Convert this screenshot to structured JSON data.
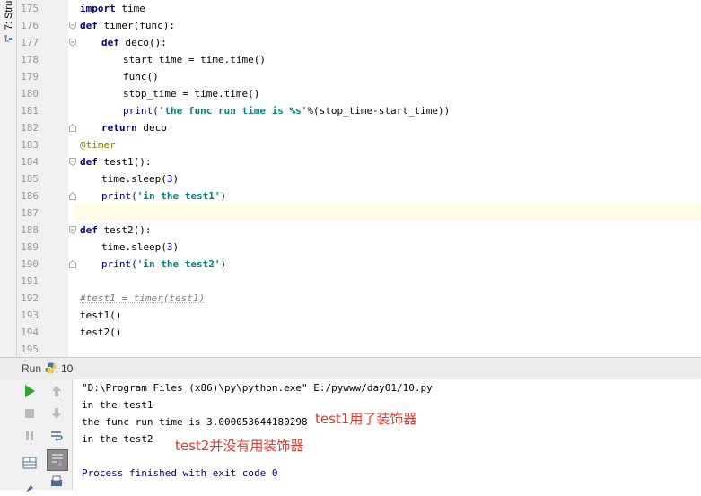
{
  "sidebar": {
    "structure_tab": "7: Stru"
  },
  "editor": {
    "line_numbers": [
      "175",
      "176",
      "177",
      "178",
      "179",
      "180",
      "181",
      "182",
      "183",
      "184",
      "185",
      "186",
      "187",
      "188",
      "189",
      "190",
      "191",
      "192",
      "193",
      "194",
      "195"
    ],
    "code": {
      "l175": {
        "kw": "import",
        "rest": " time"
      },
      "l176": {
        "kw": "def",
        "rest": " timer(func):"
      },
      "l177": {
        "kw": "def",
        "rest": " deco():"
      },
      "l178": "start_time = time.time()",
      "l179": "func()",
      "l180": "stop_time = time.time()",
      "l181": {
        "fn": "print(",
        "str": "'the func run time is %s'",
        "rest": "%(stop_time-start_time))"
      },
      "l182": {
        "kw": "return",
        "rest": " deco"
      },
      "l183": "@timer",
      "l184": {
        "kw": "def",
        "rest": " test1():"
      },
      "l185": {
        "pre": "time.sleep(",
        "num": "3",
        "post": ")"
      },
      "l186": {
        "fn": "print(",
        "str": "'in the test1'",
        "rest": ")"
      },
      "l188": {
        "kw": "def",
        "rest": " test2():"
      },
      "l189": {
        "pre": "time.sleep(",
        "num": "3",
        "post": ")"
      },
      "l190": {
        "fn": "print(",
        "str": "'in the test2'",
        "rest": ")"
      },
      "l192": "#test1 = timer(test1)",
      "l193": "test1()",
      "l194": "test2()"
    }
  },
  "run_panel": {
    "label": "Run",
    "config_name": "10",
    "console": [
      "\"D:\\Program Files (x86)\\py\\python.exe\" E:/pywww/day01/10.py",
      "in the test1",
      "the func run time is 3.000053644180298",
      "in the test2",
      "",
      "Process finished with exit code 0"
    ],
    "annotations": {
      "note1": "test1用了装饰器",
      "note2": "test2并没有用装饰器"
    },
    "colors": {
      "run_green": "#2ea52e",
      "annotation_red": "#e0382a"
    }
  }
}
